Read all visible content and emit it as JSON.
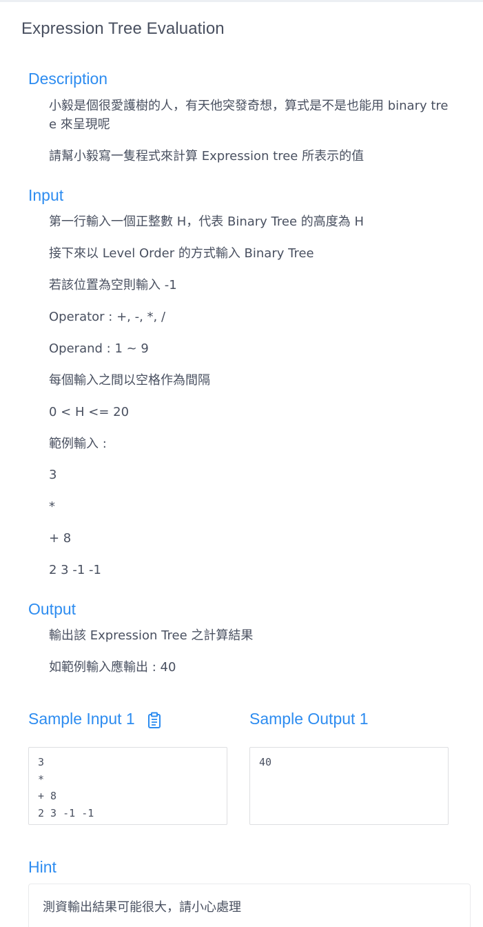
{
  "page": {
    "title": "Expression Tree Evaluation"
  },
  "description": {
    "heading": "Description",
    "paragraphs": [
      "小毅是個很愛護樹的人，有天他突發奇想，算式是不是也能用 binary tree 來呈現呢",
      "請幫小毅寫一隻程式來計算 Expression tree 所表示的值"
    ]
  },
  "input": {
    "heading": "Input",
    "paragraphs": [
      "第一行輸入一個正整數 H，代表 Binary Tree 的高度為 H",
      "接下來以 Level Order 的方式輸入 Binary Tree",
      "若該位置為空則輸入 -1",
      "Operator : +, -, *, /",
      "Operand : 1 ~ 9",
      "每個輸入之間以空格作為間隔",
      "0 < H <= 20",
      "範例輸入 :",
      "3",
      "*",
      "+ 8",
      "2 3 -1 -1"
    ]
  },
  "output": {
    "heading": "Output",
    "paragraphs": [
      "輸出該 Expression Tree 之計算結果",
      "如範例輸入應輸出 : 40"
    ]
  },
  "samples": {
    "input_label": "Sample Input 1",
    "output_label": "Sample Output 1",
    "input_text": "3\n*\n+ 8\n2 3 -1 -1",
    "output_text": "40",
    "copy_icon": "clipboard-icon",
    "accent": "#2d8cf0"
  },
  "hint": {
    "heading": "Hint",
    "text": "測資輸出結果可能很大，請小心處理"
  }
}
